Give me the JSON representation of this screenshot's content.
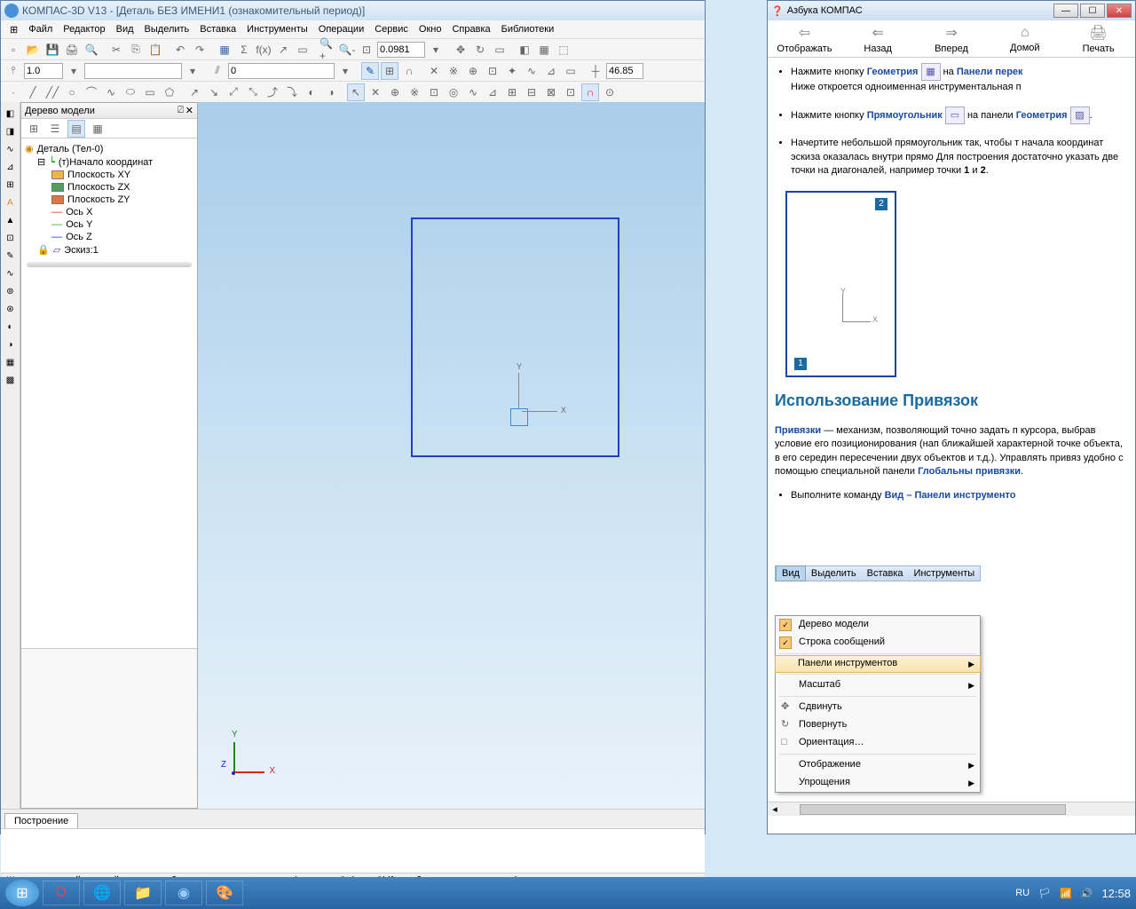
{
  "main": {
    "title": "КОМПАС-3D V13 - [Деталь БЕЗ ИМЕНИ1 (ознакомительный период)]",
    "menus": [
      "Файл",
      "Редактор",
      "Вид",
      "Выделить",
      "Вставка",
      "Инструменты",
      "Операции",
      "Сервис",
      "Окно",
      "Справка",
      "Библиотеки"
    ],
    "scale1": "1.0",
    "zoom_value": "0.0981",
    "coord_value": "46.85",
    "style_value": "0",
    "tree": {
      "title": "Дерево модели",
      "root": "Деталь (Тел-0)",
      "origin": "(т)Начало координат",
      "planes": [
        "Плоскость XY",
        "Плоскость ZX",
        "Плоскость ZY"
      ],
      "axes": [
        "Ось X",
        "Ось Y",
        "Ось Z"
      ],
      "sketch": "Эскиз:1"
    },
    "tab": "Построение",
    "status": "Щелкните левой кнопкой мыши на объекте для его выделения (вместе с Ctrl или Shift - добавить к выделенным)"
  },
  "help": {
    "title": "Азбука КОМПАС",
    "nav": [
      "Отображать",
      "Назад",
      "Вперед",
      "Домой",
      "Печать"
    ],
    "bullet1a": "Нажмите кнопку",
    "bullet1b": "Геометрия",
    "bullet1c": "на",
    "bullet1d": "Панели перек",
    "bullet1e": "Ниже откроется одноименная инструментальная п",
    "bullet2a": "Нажмите кнопку",
    "bullet2b": "Прямоугольник",
    "bullet2c": "на панели",
    "bullet2d": "Геометрия",
    "bullet3a": "Начертите небольшой прямоугольник так, чтобы т",
    "bullet3b": "начала координат эскиза оказалась внутри прямо",
    "bullet3c": "Для построения достаточно указать две точки на",
    "bullet3d": "диагоналей, например точки",
    "bullet3e": "1",
    "bullet3f": "и",
    "bullet3g": "2",
    "heading": "Использование Привязок",
    "para1a": "Привязки",
    "para1b": "— механизм, позволяющий точно задать п курсора, выбрав условие его позиционирования (нап ближайшей характерной точке объекта, в его середин пересечении двух объектов и т.д.). Управлять привяз удобно с помощью специальной панели",
    "para1c": "Глобальны привязки",
    "bullet4a": "Выполните команду",
    "bullet4b": "Вид – Панели инструменто",
    "ctx_menubar": [
      "Вид",
      "Выделить",
      "Вставка",
      "Инструменты"
    ],
    "ctx_items": [
      {
        "label": "Дерево модели",
        "check": true
      },
      {
        "label": "Строка сообщений",
        "check": true
      },
      {
        "label": "Панели инструментов",
        "hl": true,
        "arrow": true
      },
      {
        "label": "Масштаб",
        "arrow": true
      },
      {
        "label": "Сдвинуть",
        "icon": "✥"
      },
      {
        "label": "Повернуть",
        "icon": "↻"
      },
      {
        "label": "Ориентация…",
        "icon": "□"
      },
      {
        "label": "Отображение",
        "arrow": true
      },
      {
        "label": "Упрощения",
        "arrow": true
      }
    ]
  },
  "taskbar": {
    "lang": "RU",
    "time": "12:58"
  }
}
